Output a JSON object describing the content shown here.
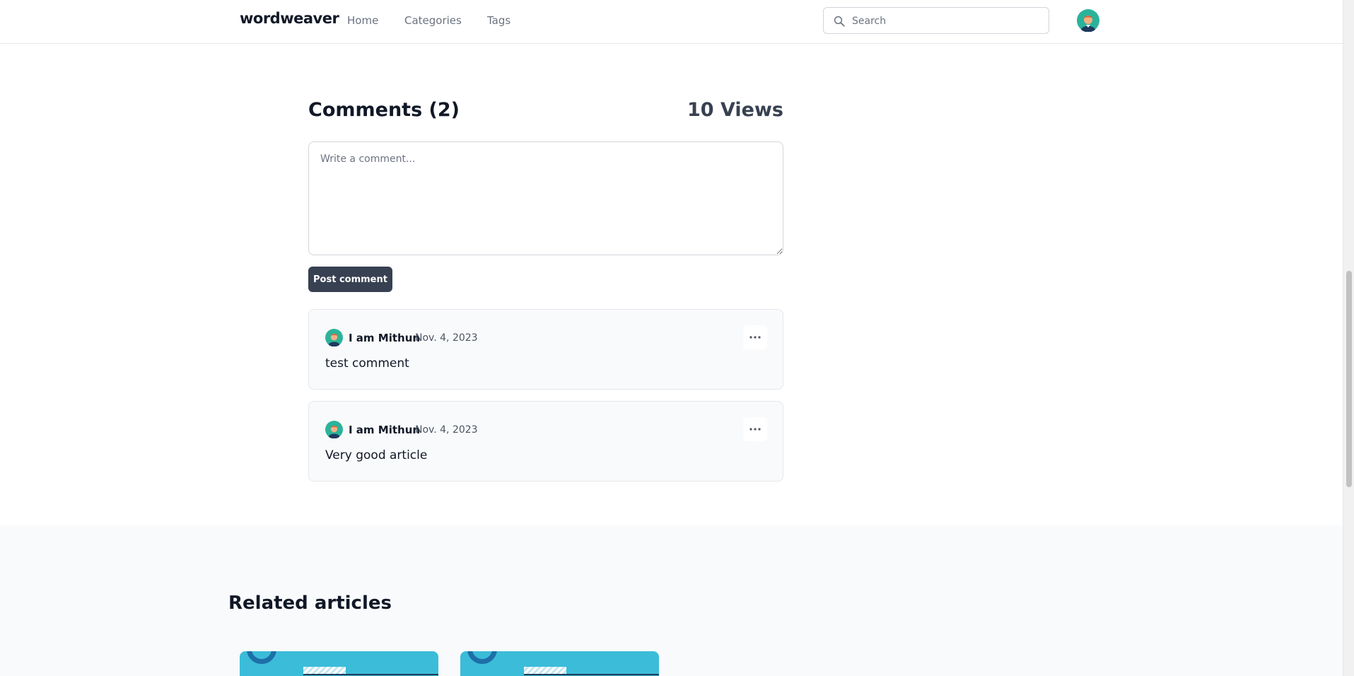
{
  "header": {
    "logo": "wordweaver",
    "nav": [
      "Home",
      "Categories",
      "Tags"
    ],
    "search_placeholder": "Search"
  },
  "comments_section": {
    "title": "Comments (2)",
    "views": "10 Views",
    "input_placeholder": "Write a comment...",
    "post_button": "Post comment",
    "comments": [
      {
        "author": "I am Mithun",
        "date": "Nov. 4, 2023",
        "text": "test comment"
      },
      {
        "author": "I am Mithun",
        "date": "Nov. 4, 2023",
        "text": "Very good article"
      }
    ]
  },
  "related": {
    "title": "Related articles"
  },
  "colors": {
    "accent_dark": "#374151",
    "card_cyan": "#3bbcd9",
    "avatar_teal": "#2bb39a"
  }
}
